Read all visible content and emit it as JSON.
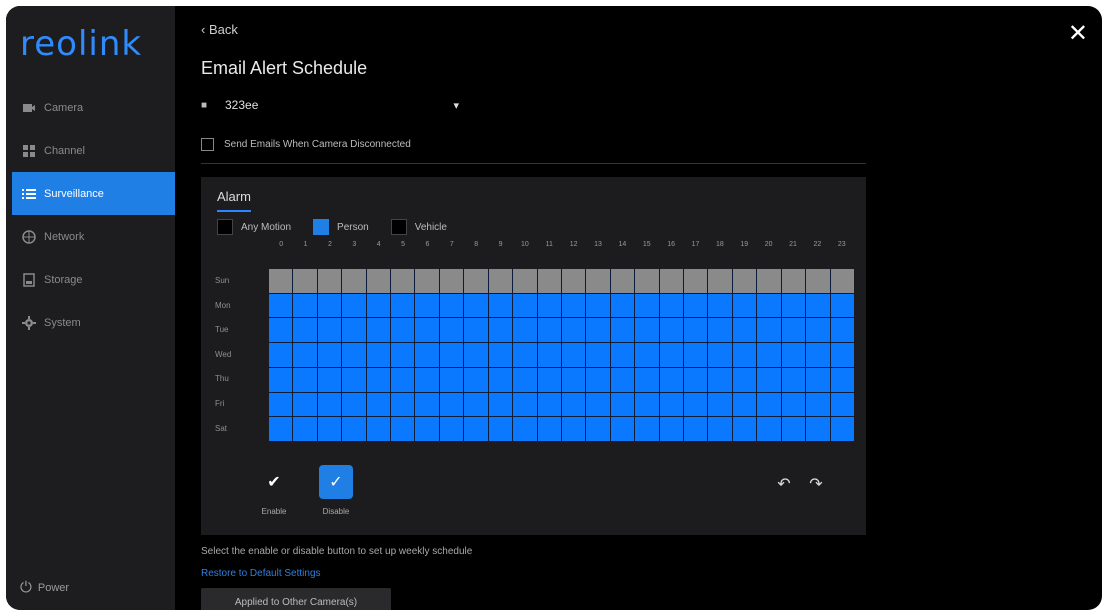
{
  "app": {
    "logo_text": "reolink",
    "brand_color": "#2f8cff"
  },
  "sidebar": {
    "items": [
      {
        "label": "Camera",
        "icon": "camera-icon",
        "active": false
      },
      {
        "label": "Channel",
        "icon": "channel-icon",
        "active": false
      },
      {
        "label": "Surveillance",
        "icon": "list-icon",
        "active": true
      },
      {
        "label": "Network",
        "icon": "globe-icon",
        "active": false
      },
      {
        "label": "Storage",
        "icon": "storage-icon",
        "active": false
      },
      {
        "label": "System",
        "icon": "gear-icon",
        "active": false
      }
    ],
    "power_label": "Power"
  },
  "header": {
    "back_label": "Back",
    "title": "Email Alert Schedule",
    "close_icon": "close-icon"
  },
  "camera_select": {
    "value": "323ee",
    "icon": "camera-icon"
  },
  "disconnect_checkbox": {
    "label": "Send Emails When Camera Disconnected",
    "checked": false
  },
  "schedule": {
    "tab_label": "Alarm",
    "legend": [
      {
        "label": "Any Motion",
        "color": "#000000"
      },
      {
        "label": "Person",
        "color": "#1f7fe5"
      },
      {
        "label": "Vehicle",
        "color": "#000000"
      }
    ],
    "hours": [
      "0",
      "1",
      "2",
      "3",
      "4",
      "5",
      "6",
      "7",
      "8",
      "9",
      "10",
      "11",
      "12",
      "13",
      "14",
      "15",
      "16",
      "17",
      "18",
      "19",
      "20",
      "21",
      "22",
      "23"
    ],
    "days": [
      "Sun",
      "Mon",
      "Tue",
      "Wed",
      "Thu",
      "Fri",
      "Sat"
    ],
    "day_state": [
      "disabled",
      "enabled",
      "enabled",
      "enabled",
      "enabled",
      "enabled",
      "enabled"
    ],
    "enabled_color": "#0a78ff",
    "disabled_color": "#8a8a8a",
    "tools": [
      {
        "label": "Enable",
        "icon": "brush-icon",
        "selected": false
      },
      {
        "label": "Disable",
        "icon": "eraser-icon",
        "selected": true
      }
    ],
    "undo_icon": "undo-icon",
    "redo_icon": "redo-icon"
  },
  "footer": {
    "hint": "Select the enable or disable button to set up weekly schedule",
    "restore_link": "Restore to Default Settings",
    "apply_button": "Applied to Other Camera(s)"
  }
}
